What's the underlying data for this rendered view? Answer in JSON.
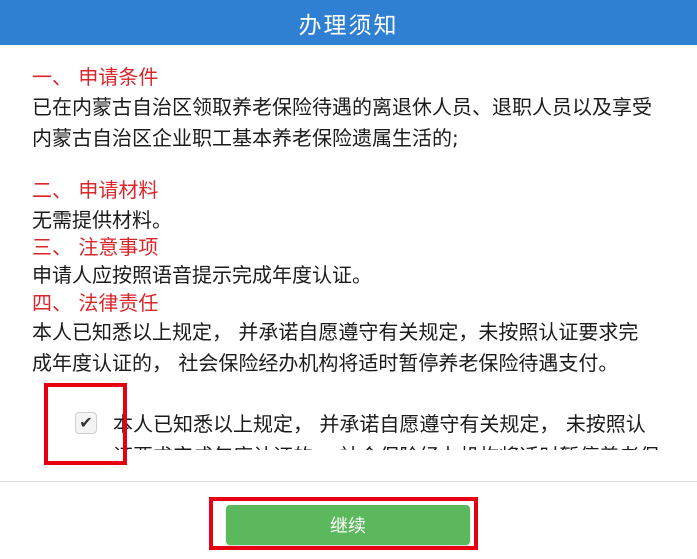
{
  "header": {
    "title": "办理须知"
  },
  "sections": [
    {
      "title": "一、 申请条件",
      "body": "已在内蒙古自治区领取养老保险待遇的离退休人员、退职人员以及享受内蒙古自治区企业职工基本养老保险遗属生活的;"
    },
    {
      "title": "二、 申请材料",
      "body": "无需提供材料。"
    },
    {
      "title": "三、 注意事项",
      "body": "申请人应按照语音提示完成年度认证。"
    },
    {
      "title": "四、 法律责任",
      "body": "本人已知悉以上规定， 并承诺自愿遵守有关规定，未按照认证要求完成年度认证的， 社会保险经办机构将适时暂停养老保险待遇支付。"
    }
  ],
  "consent": {
    "checked": true,
    "check_glyph": "✔",
    "text": "本人已知悉以上规定， 并承诺自愿遵守有关规定， 未按照认证要求完成年度认证的， 社会保险经办机构将适时暂停养老保险待遇支付。"
  },
  "footer": {
    "continue_label": "继续"
  },
  "colors": {
    "header_bg": "#2f7fd3",
    "section_title": "#d9262b",
    "button_bg": "#5cb85c",
    "highlight_box": "#e60012"
  }
}
